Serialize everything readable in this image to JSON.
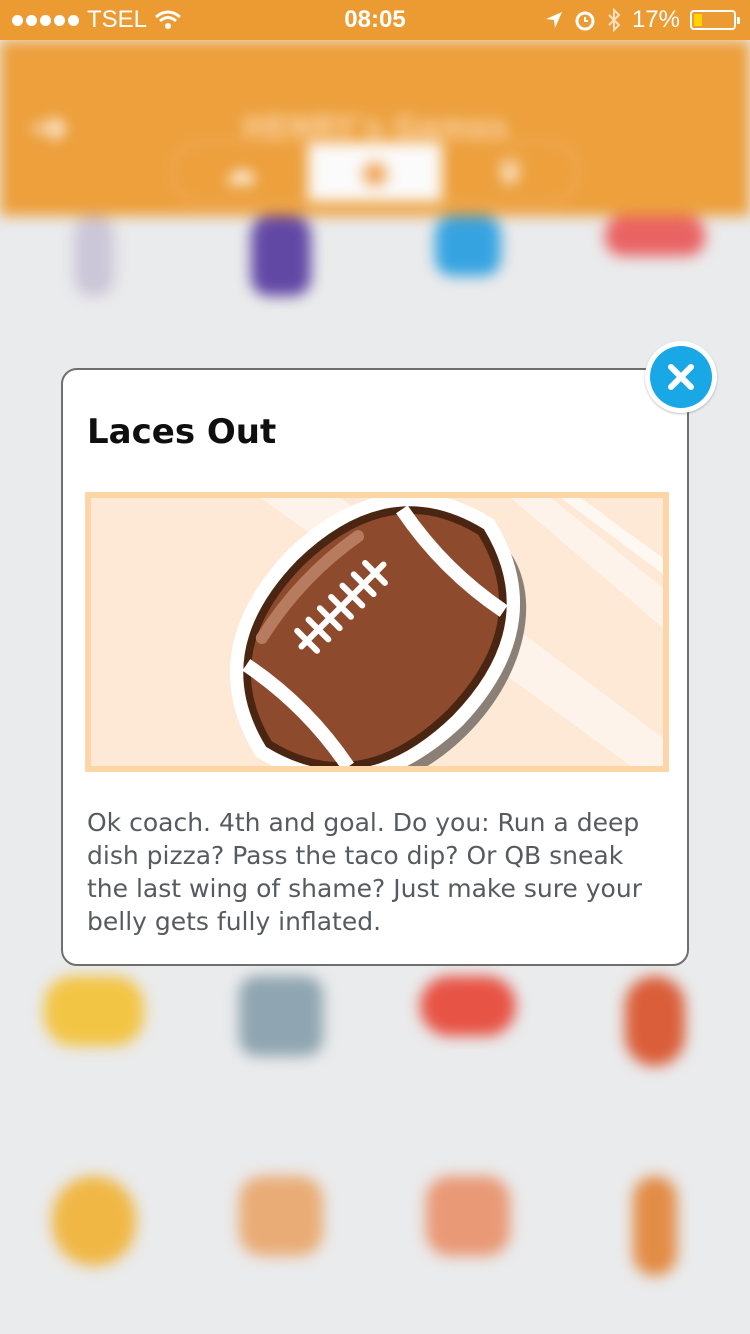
{
  "status_bar": {
    "carrier": "TSEL",
    "time": "08:05",
    "battery_percent": "17%",
    "battery_level": 0.17
  },
  "header": {
    "back_icon": "back-arrow-icon",
    "title": "HENRY's Games",
    "segments": [
      {
        "icon": "cloud-icon"
      },
      {
        "icon": "game-icon",
        "selected": true
      },
      {
        "icon": "crown-icon"
      }
    ]
  },
  "modal": {
    "title": "Laces Out",
    "description": "Ok coach. 4th and goal. Do you: Run a deep dish pizza? Pass the taco dip? Or QB sneak the last wing of shame? Just make sure your belly gets fully inflated.",
    "close_icon": "close-icon",
    "image_icon": "football-icon"
  },
  "colors": {
    "accent": "#ec9b32",
    "close_button": "#1aa7e6",
    "banner_border": "#fdd6a7",
    "banner_bg": "#fde9d5"
  }
}
